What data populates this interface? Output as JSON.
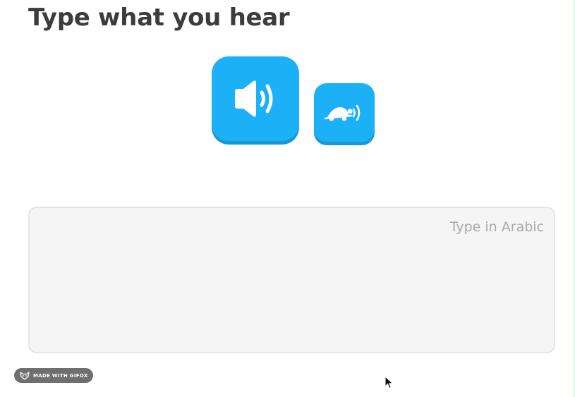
{
  "challenge": {
    "title": "Type what you hear",
    "play_audio_icon": "speaker-icon",
    "play_slow_audio_icon": "turtle-speaker-icon"
  },
  "answer": {
    "placeholder": "Type in Arabic",
    "value": ""
  },
  "watermark": {
    "label": "MADE WITH GIFOX",
    "icon": "fox-icon"
  },
  "colors": {
    "accent": "#1cb0f6",
    "accent_shadow": "#1899d6",
    "title": "#3c3c3c",
    "input_bg": "#f5f5f5",
    "input_border": "#e5e5e5",
    "placeholder": "#a8a8a8"
  }
}
